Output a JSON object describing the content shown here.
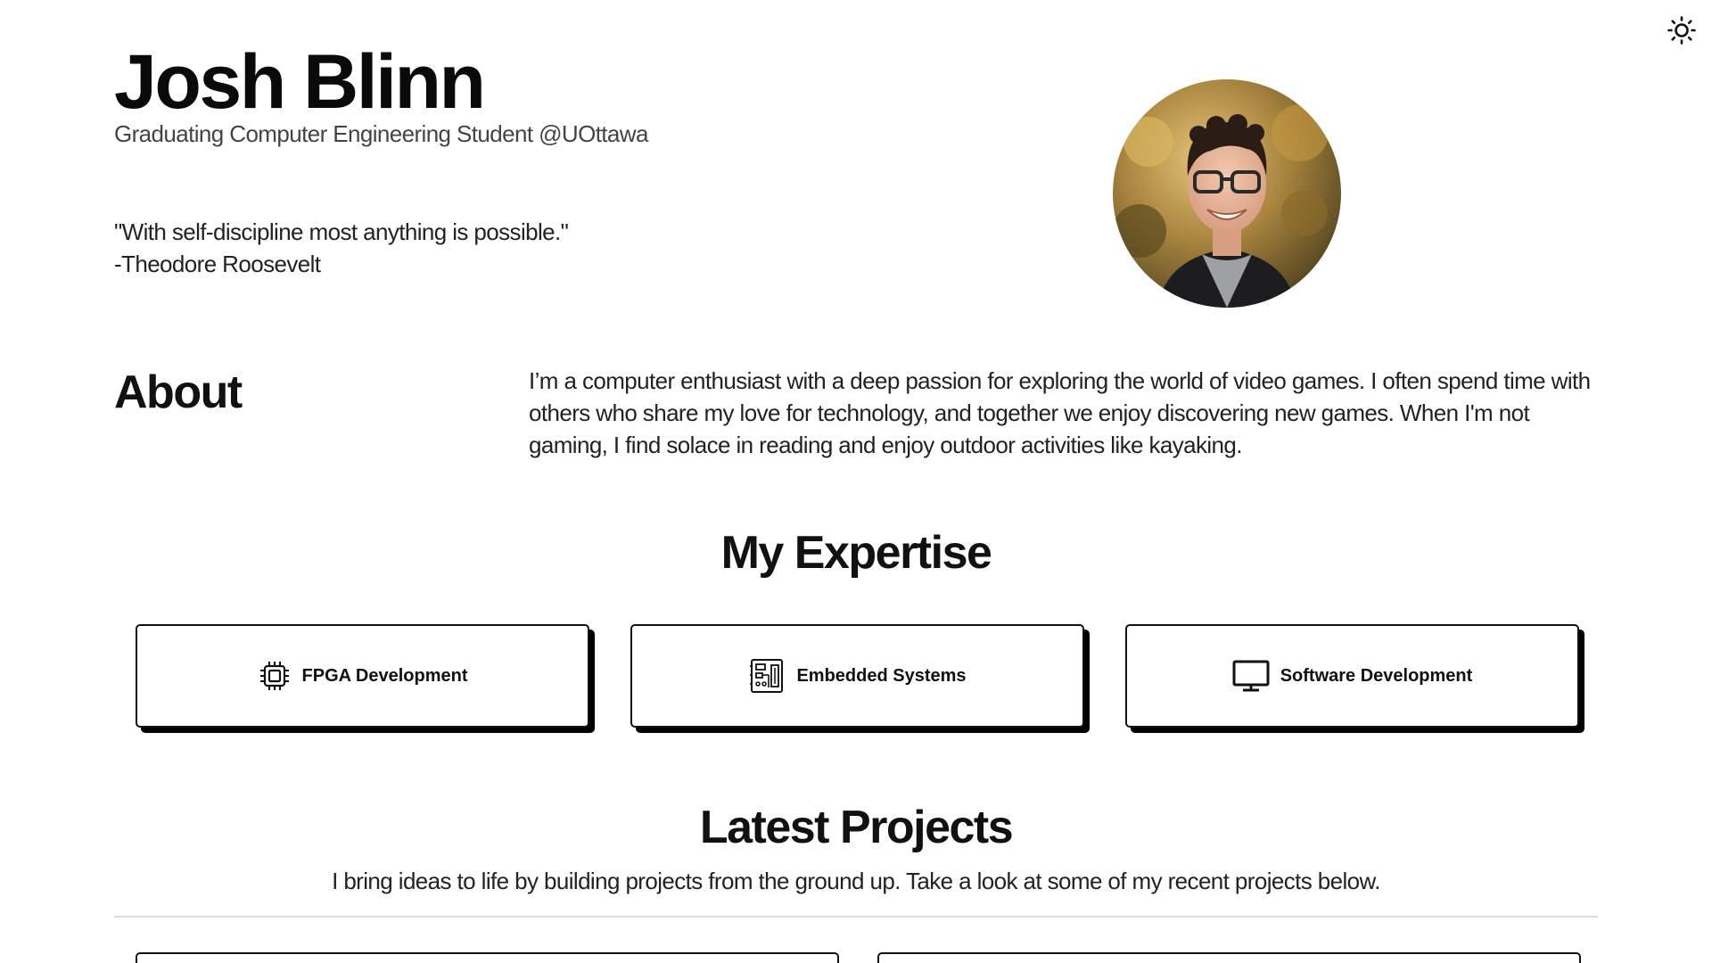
{
  "header": {
    "theme_toggle_icon": "sun-icon"
  },
  "hero": {
    "name": "Josh Blinn",
    "subtitle": "Graduating Computer Engineering Student @UOttawa",
    "quote_line1": "\"With self-discipline most anything is possible.\"",
    "quote_line2": "-Theodore Roosevelt",
    "avatar_icon": "profile-photo"
  },
  "about": {
    "title": "About",
    "text": "I’m a computer enthusiast with a deep passion for exploring the world of video games. I often spend time with others who share my love for technology, and together we enjoy discovering new games. When I'm not gaming, I find solace in reading and enjoy outdoor activities like kayaking."
  },
  "expertise": {
    "title": "My Expertise",
    "cards": [
      {
        "label": "FPGA Development",
        "icon": "chip-icon"
      },
      {
        "label": "Embedded Systems",
        "icon": "circuit-board-icon"
      },
      {
        "label": "Software Development",
        "icon": "monitor-icon"
      }
    ]
  },
  "projects": {
    "title": "Latest Projects",
    "subtitle": "I bring ideas to life by building projects from the ground up. Take a look at some of my recent projects below."
  },
  "colors": {
    "text": "#111111",
    "muted": "#444444",
    "divider": "#dcdcdc",
    "card_border": "#111111"
  }
}
